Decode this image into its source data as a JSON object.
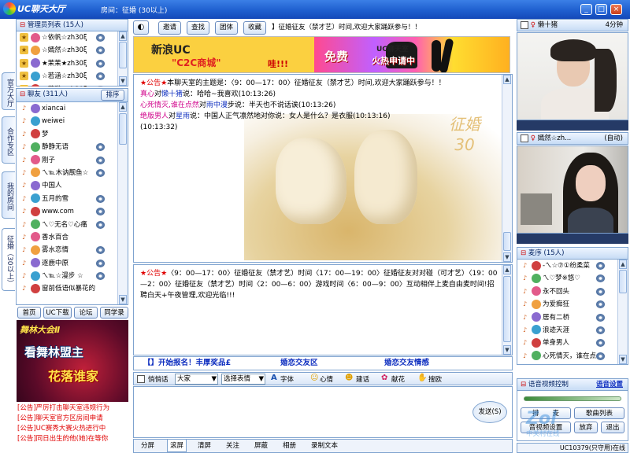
{
  "window": {
    "title": "UC聊天大厅",
    "room_label": "房间：征婚 (30以上)"
  },
  "admin_list": {
    "header": "管理员列表 (15人)",
    "items": [
      {
        "name": "☆依帆☆zh30ξ"
      },
      {
        "name": "☆嫣然☆zh30ξ"
      },
      {
        "name": "★茉茉★zh30ξ"
      },
      {
        "name": "☆若涵☆zh30ξ"
      },
      {
        "name": "☆花猫☆zh30ξ"
      }
    ]
  },
  "side_tabs": [
    "官方大厅",
    "合作专区",
    "我的房间",
    "征婚（30以上）"
  ],
  "chat_list": {
    "header": "聊友 (311人)",
    "sort_label": "排序",
    "items": [
      {
        "name": "xiancai"
      },
      {
        "name": "weiwei"
      },
      {
        "name": "梦"
      },
      {
        "name": "静静无语"
      },
      {
        "name": "刚子"
      },
      {
        "name": "ㄟ℡木讷靓鱼☆"
      },
      {
        "name": "中国人"
      },
      {
        "name": "五月的雪"
      },
      {
        "name": "www.com"
      },
      {
        "name": "ㄟ♡无名♡心痛"
      },
      {
        "name": "香水百合"
      },
      {
        "name": "雾水恋情"
      },
      {
        "name": "逐鹿中原"
      },
      {
        "name": "ㄟ℡☆漫步 ☆"
      },
      {
        "name": "窗前低语似暴花的"
      }
    ]
  },
  "left_links": [
    "首页",
    "UC下载",
    "论坛",
    "同学录"
  ],
  "ad_banner": {
    "line1": "舞林大会Ⅱ",
    "line2": "看舞林盟主",
    "line3": "花落谁家"
  },
  "announcements": [
    {
      "tag": "[公告]",
      "text": "严厉打击聊天室违规行为"
    },
    {
      "tag": "[公告]",
      "text": "聊天室官方区房间申请"
    },
    {
      "tag": "[公告]",
      "text": "UC赛秀大赛火热进行中"
    },
    {
      "tag": "[公告]",
      "text": "同日出生的他(她)在等你"
    }
  ],
  "toolbar": {
    "invite": "邀请",
    "find": "查找",
    "group": "团体",
    "favorite": "收藏",
    "marquee": "】征婚征友（禁才艺）时间,欢迎大家踊跃参与！！"
  },
  "banner": {
    "brand": "新浪UC",
    "slogan": "\"C2C商城\"",
    "wa": "哇!!!",
    "free": "免费",
    "ucroom": "UC聊天室",
    "hot": "火热申请中"
  },
  "chat": {
    "messages": [
      {
        "prefix": "★公告★",
        "text": "本聊天室的主题是：〈9：00—17：00〉征婚征友（禁才艺）时间,欢迎大家踊跃参与！！"
      },
      {
        "who": "真心",
        "mid": "对",
        "target": "懒十猪",
        "say": "说：哈哈~我喜欢(10:13:26)"
      },
      {
        "who": "心死情灭,谁在点然",
        "mid": "对",
        "target": "雨中漫",
        "say": "步说：半天也不说话诶(10:13:26)"
      },
      {
        "who": "绝版男人",
        "mid": "对",
        "target": "星雨",
        "say": "说：中国人正气凛然地对你说：女人是什么？是衣服(10:13:16)"
      },
      {
        "text": "(10:13:32)"
      }
    ],
    "watermark": "征婚30"
  },
  "lower_chat": {
    "prefix": "★公告★",
    "text": "〈9：00—17：00〉征婚征友（禁才艺）时间〈17：00—19：00〉征婚征友对对碰（可才艺）〈19：00—2：00〉征婚征友（禁才艺）时间〈2：00—6：00〉游戏时间〈6：00—9：00〉互动相伴上麦自由麦时间!招聘白天+午夜管理,欢迎光临!!!"
  },
  "promo": {
    "left": "【】开始报名！丰厚奖品£",
    "mid": "婚恋交友区",
    "right": "婚恋交友情感"
  },
  "input_bar": {
    "whisper": "悄悄话",
    "target": "大家",
    "emote_placeholder": "选择表情",
    "font": "字体",
    "mood": "心情",
    "dress": "建话",
    "flower": "献花",
    "kick": "搜欧"
  },
  "send_label": "发送(S)",
  "bottom_tabs": [
    "分屏",
    "滚屏",
    "清屏",
    "关注",
    "屏蔽",
    "相册",
    "录制文本"
  ],
  "video1": {
    "name": "懒十猪",
    "time": "4分钟"
  },
  "video2": {
    "name": "嫣然☆zh...",
    "mode": "(自动)"
  },
  "mic_list": {
    "header": "麦序 (15人)",
    "items": [
      {
        "name": "-ㄟ☆⑦①纷柔菜"
      },
      {
        "name": "ㄟ♡梦※悠♡"
      },
      {
        "name": "永不回头"
      },
      {
        "name": "为爱痴狂"
      },
      {
        "name": "居有二桥"
      },
      {
        "name": "浪迹天涯"
      },
      {
        "name": "单身男人"
      },
      {
        "name": "心死情灭，谁在点"
      }
    ]
  },
  "voice": {
    "header": "语音视频控制",
    "settings": "语音设置",
    "queue": "排　　麦",
    "song": "歌曲列表",
    "av_ctrl": "音视频设置",
    "abandon": "放弃",
    "exit": "退出"
  },
  "status_bar": {
    "id": "UC10379(只守用)在线"
  },
  "watermark_corner": {
    "brand": "Zol",
    "sub": "中关村在线"
  }
}
